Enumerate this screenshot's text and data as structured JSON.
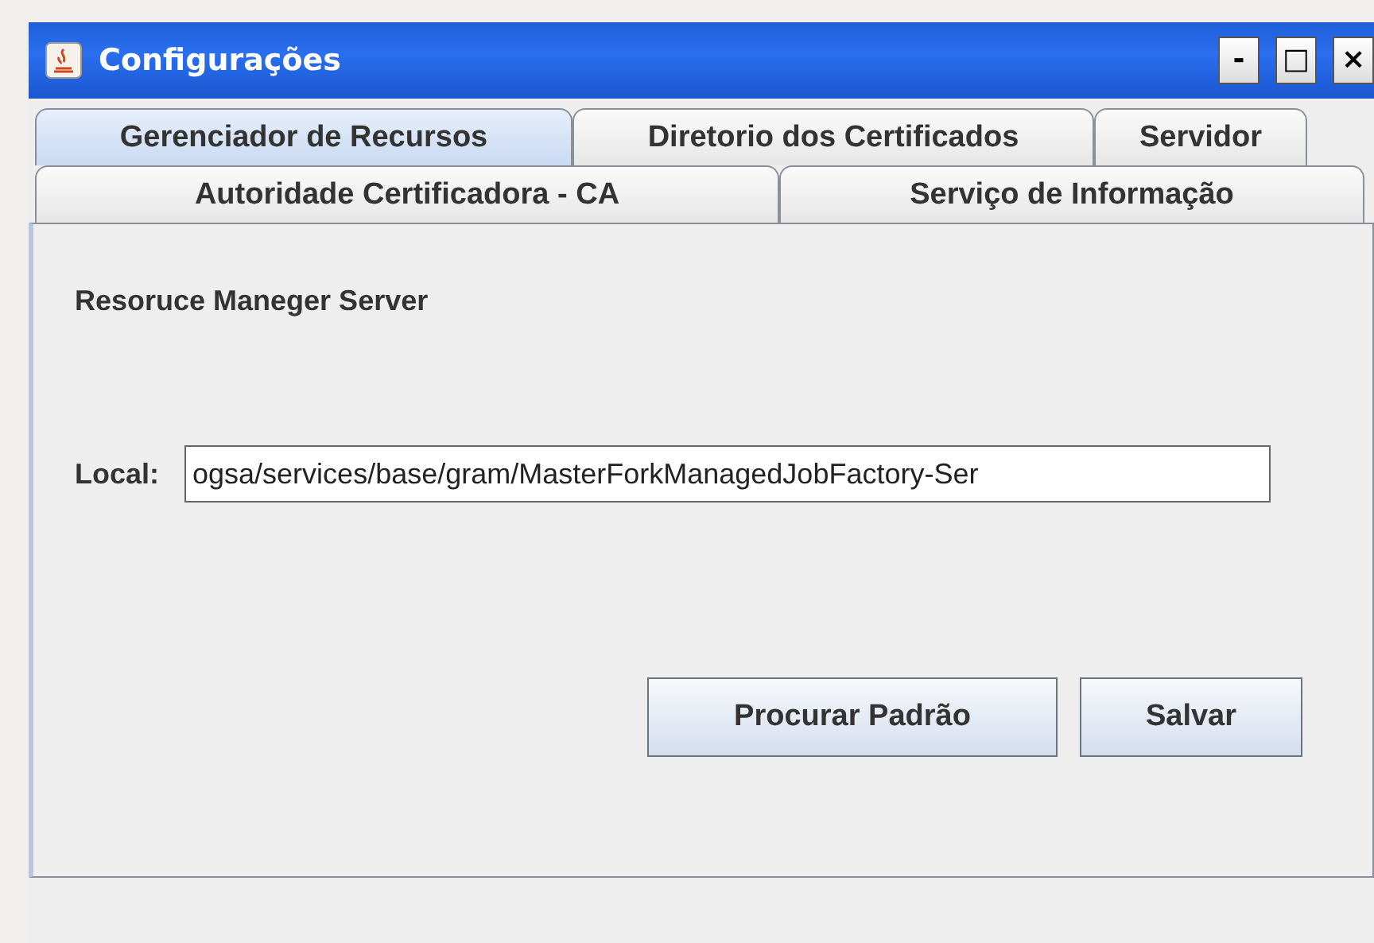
{
  "window": {
    "title": "Configurações",
    "controls": [
      "-",
      "□",
      "×"
    ]
  },
  "tab_rows": [
    [
      {
        "label": "Gerenciador de Recursos",
        "selected": true
      },
      {
        "label": "Diretorio dos Certificados",
        "selected": false
      },
      {
        "label": "Servidor",
        "selected": false
      }
    ],
    [
      {
        "label": "Autoridade Certificadora - CA",
        "selected": false
      },
      {
        "label": "Serviço de Informação",
        "selected": false
      }
    ]
  ],
  "panel": {
    "heading": "Resoruce Maneger Server",
    "field": {
      "label": "Local:",
      "value": "ogsa/services/base/gram/MasterForkManagedJobFactory-Ser"
    },
    "buttons": [
      "Procurar Padrão",
      "Salvar"
    ]
  }
}
